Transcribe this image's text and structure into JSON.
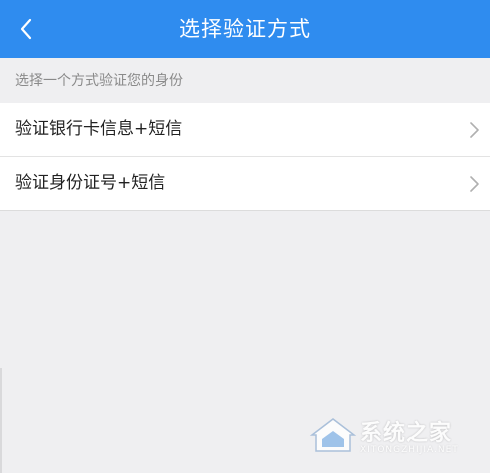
{
  "header": {
    "title": "选择验证方式",
    "back_icon": "chevron-left-icon",
    "background_color": "#2f8cef"
  },
  "hint": {
    "text": "选择一个方式验证您的身份"
  },
  "options": [
    {
      "label": "验证银行卡信息+短信",
      "icon": "chevron-right-icon"
    },
    {
      "label": "验证身份证号+短信",
      "icon": "chevron-right-icon"
    }
  ],
  "watermark": {
    "brand": "系统之家",
    "site": "XITONGZHIJIA.NET"
  }
}
